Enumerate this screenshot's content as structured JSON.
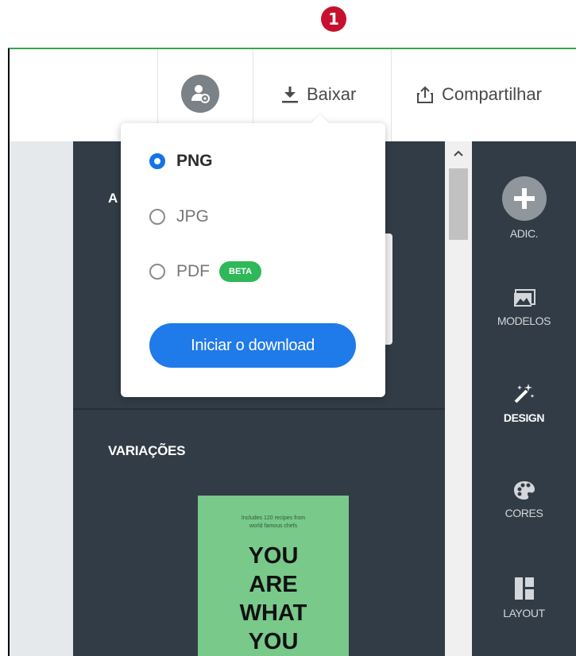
{
  "marker": "1",
  "toolbar": {
    "download_label": "Baixar",
    "share_label": "Compartilhar"
  },
  "download_menu": {
    "formats": [
      {
        "label": "PNG",
        "selected": true
      },
      {
        "label": "JPG",
        "selected": false
      },
      {
        "label": "PDF",
        "selected": false,
        "badge": "BETA"
      }
    ],
    "start_button": "Iniciar o download"
  },
  "panel": {
    "top_title_partial": "A",
    "variations_title": "VARIAÇÕES"
  },
  "thumbnail": {
    "small_text_line1": "Includes 120 recipes from",
    "small_text_line2": "world famous chefs",
    "big_text": [
      "YOU",
      "ARE",
      "WHAT",
      "YOU"
    ]
  },
  "rail": {
    "items": [
      {
        "label": "ADIC.",
        "icon": "plus-icon"
      },
      {
        "label": "MODELOS",
        "icon": "image-icon"
      },
      {
        "label": "DESIGN",
        "icon": "magic-wand-icon",
        "active": true
      },
      {
        "label": "CORES",
        "icon": "palette-icon"
      },
      {
        "label": "LAYOUT",
        "icon": "layout-icon"
      }
    ]
  },
  "colors": {
    "accent_blue": "#1f7aea",
    "beta_green": "#2eb857",
    "panel_dark": "#323c46",
    "marker_red": "#c8102e"
  }
}
